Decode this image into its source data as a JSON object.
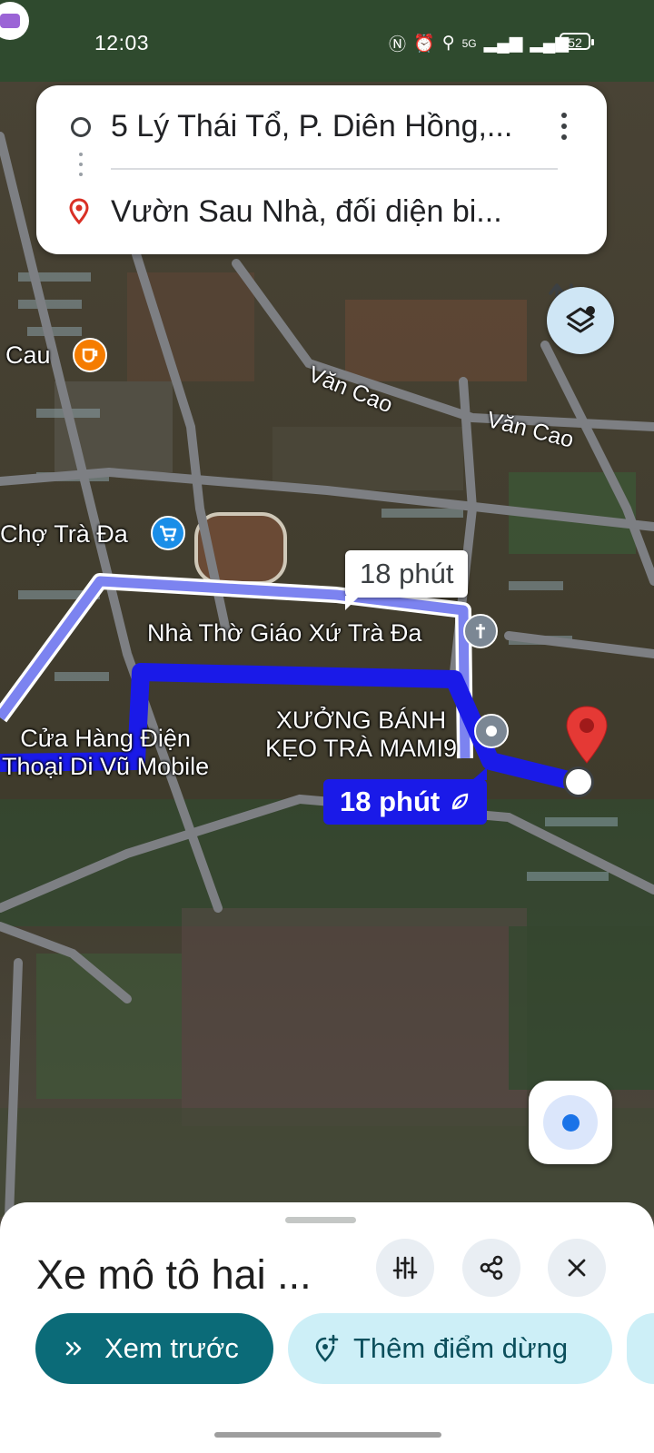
{
  "status_bar": {
    "time": "12:03",
    "network": "5G",
    "battery": "52",
    "icons": [
      "nfc-icon",
      "alarm-icon",
      "location-icon",
      "signal-icon",
      "signal-icon-2",
      "battery-icon"
    ]
  },
  "route": {
    "origin": "5 Lý Thái Tổ, P. Diên Hồng,...",
    "destination": "Vườn Sau Nhà, đối diện bi..."
  },
  "map": {
    "labels": {
      "cafe": "Cau",
      "market": "Chợ Trà Đa",
      "road_1": "Văn Cao",
      "road_2": "Văn Cao",
      "church": "Nhà Thờ Giáo Xứ Trà Đa",
      "factory_line1": "XƯỞNG BÁNH",
      "factory_line2": "KẸO TRÀ MAMI9",
      "shop_line1": "Cửa Hàng Điện",
      "shop_line2": "Thoại Di Vũ Mobile"
    },
    "eta_alternate": "18 phút",
    "eta_main": "18 phút"
  },
  "bottom_sheet": {
    "mode_title": "Xe mô tô hai ...",
    "preview_label": "Xem trước",
    "add_stop_label": "Thêm điểm dừng"
  },
  "colors": {
    "route_primary": "#1a1ae8",
    "route_alternate": "#7c83f0",
    "destination_pin": "#e53935",
    "primary_button": "#0b6b78",
    "secondary_button": "#cdeff7"
  }
}
